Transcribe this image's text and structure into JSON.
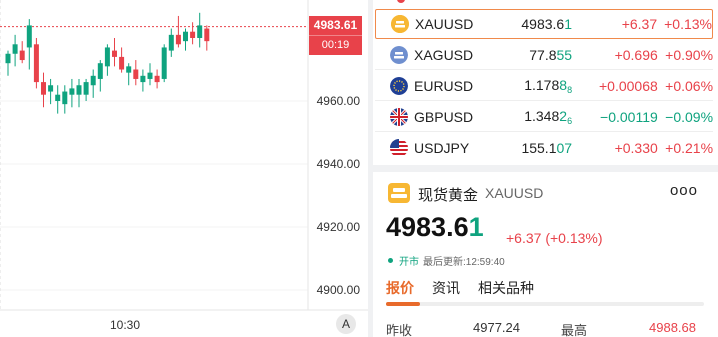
{
  "chart": {
    "y_axis_labels": [
      "4960.00",
      "4940.00",
      "4920.00",
      "4900.00"
    ],
    "x_axis_labels": [
      "10:30"
    ],
    "current_price": "4983.61",
    "countdown": "00:19",
    "auto_scale_label": "A"
  },
  "chart_data": {
    "type": "candlestick",
    "y_ticks": [
      4960,
      4940,
      4920,
      4900
    ],
    "x_ticks": [
      "10:30"
    ],
    "last_price": 4983.61,
    "candles": [
      {
        "o": 4972,
        "h": 4976,
        "l": 4968,
        "c": 4975
      },
      {
        "o": 4975,
        "h": 4981,
        "l": 4971,
        "c": 4978
      },
      {
        "o": 4976,
        "h": 4979,
        "l": 4972,
        "c": 4973
      },
      {
        "o": 4977,
        "h": 4986,
        "l": 4970,
        "c": 4984
      },
      {
        "o": 4978,
        "h": 4980,
        "l": 4964,
        "c": 4966
      },
      {
        "o": 4966,
        "h": 4969,
        "l": 4958,
        "c": 4962
      },
      {
        "o": 4963,
        "h": 4967,
        "l": 4959,
        "c": 4965
      },
      {
        "o": 4960,
        "h": 4965,
        "l": 4956,
        "c": 4962
      },
      {
        "o": 4959,
        "h": 4965,
        "l": 4956,
        "c": 4963
      },
      {
        "o": 4962,
        "h": 4967,
        "l": 4958,
        "c": 4964
      },
      {
        "o": 4962,
        "h": 4967,
        "l": 4958,
        "c": 4965
      },
      {
        "o": 4962,
        "h": 4967,
        "l": 4960,
        "c": 4966
      },
      {
        "o": 4965,
        "h": 4970,
        "l": 4961,
        "c": 4968
      },
      {
        "o": 4967,
        "h": 4973,
        "l": 4963,
        "c": 4972
      },
      {
        "o": 4971,
        "h": 4978,
        "l": 4968,
        "c": 4977
      },
      {
        "o": 4976,
        "h": 4980,
        "l": 4971,
        "c": 4974
      },
      {
        "o": 4974,
        "h": 4977,
        "l": 4969,
        "c": 4970
      },
      {
        "o": 4969,
        "h": 4972,
        "l": 4965,
        "c": 4971
      },
      {
        "o": 4970,
        "h": 4973,
        "l": 4965,
        "c": 4967
      },
      {
        "o": 4966,
        "h": 4970,
        "l": 4963,
        "c": 4968
      },
      {
        "o": 4967,
        "h": 4972,
        "l": 4965,
        "c": 4969
      },
      {
        "o": 4968,
        "h": 4970,
        "l": 4964,
        "c": 4966
      },
      {
        "o": 4967,
        "h": 4978,
        "l": 4966,
        "c": 4977
      },
      {
        "o": 4976,
        "h": 4983,
        "l": 4974,
        "c": 4981
      },
      {
        "o": 4981,
        "h": 4987,
        "l": 4977,
        "c": 4978
      },
      {
        "o": 4979,
        "h": 4983,
        "l": 4976,
        "c": 4982
      },
      {
        "o": 4982,
        "h": 4985,
        "l": 4978,
        "c": 4980
      },
      {
        "o": 4980,
        "h": 4988,
        "l": 4977,
        "c": 4984
      },
      {
        "o": 4983,
        "h": 4984,
        "l": 4976,
        "c": 4979
      }
    ]
  },
  "watchlist": [
    {
      "symbol": "XAUUSD",
      "price_main": "4983.6",
      "price_hl": "1",
      "price_small": "",
      "change": "+6.37",
      "pct": "+0.13%",
      "dir": "up",
      "flag": "gold",
      "selected": true
    },
    {
      "symbol": "XAGUSD",
      "price_main": "77.8",
      "price_hl": "55",
      "price_small": "",
      "change": "+0.696",
      "pct": "+0.90%",
      "dir": "up",
      "flag": "silver",
      "selected": false
    },
    {
      "symbol": "EURUSD",
      "price_main": "1.178",
      "price_hl": "8",
      "price_small": "8",
      "change": "+0.00068",
      "pct": "+0.06%",
      "dir": "up",
      "flag": "eu",
      "selected": false
    },
    {
      "symbol": "GBPUSD",
      "price_main": "1.348",
      "price_hl": "2",
      "price_small": "6",
      "change": "−0.00119",
      "pct": "−0.09%",
      "dir": "down",
      "flag": "gb",
      "selected": false
    },
    {
      "symbol": "USDJPY",
      "price_main": "155.1",
      "price_hl": "07",
      "price_small": "",
      "change": "+0.330",
      "pct": "+0.21%",
      "dir": "up",
      "flag": "us",
      "selected": false
    }
  ],
  "detail": {
    "name_cn": "现货黄金",
    "code": "XAUUSD",
    "more": "ooo",
    "price_main": "4983.6",
    "price_hl": "1",
    "change": "+6.37 (+0.13%)",
    "status_open": "开市",
    "last_update": "最后更新:12:59:40",
    "tabs": [
      "报价",
      "资讯",
      "相关品种"
    ],
    "stats": {
      "prev_close_label": "昨收",
      "prev_close_value": "4977.24",
      "high_label": "最高",
      "high_value": "4988.68"
    }
  },
  "colors": {
    "up": "#e8424a",
    "down": "#0fa37f",
    "accent": "#e86a2b"
  }
}
